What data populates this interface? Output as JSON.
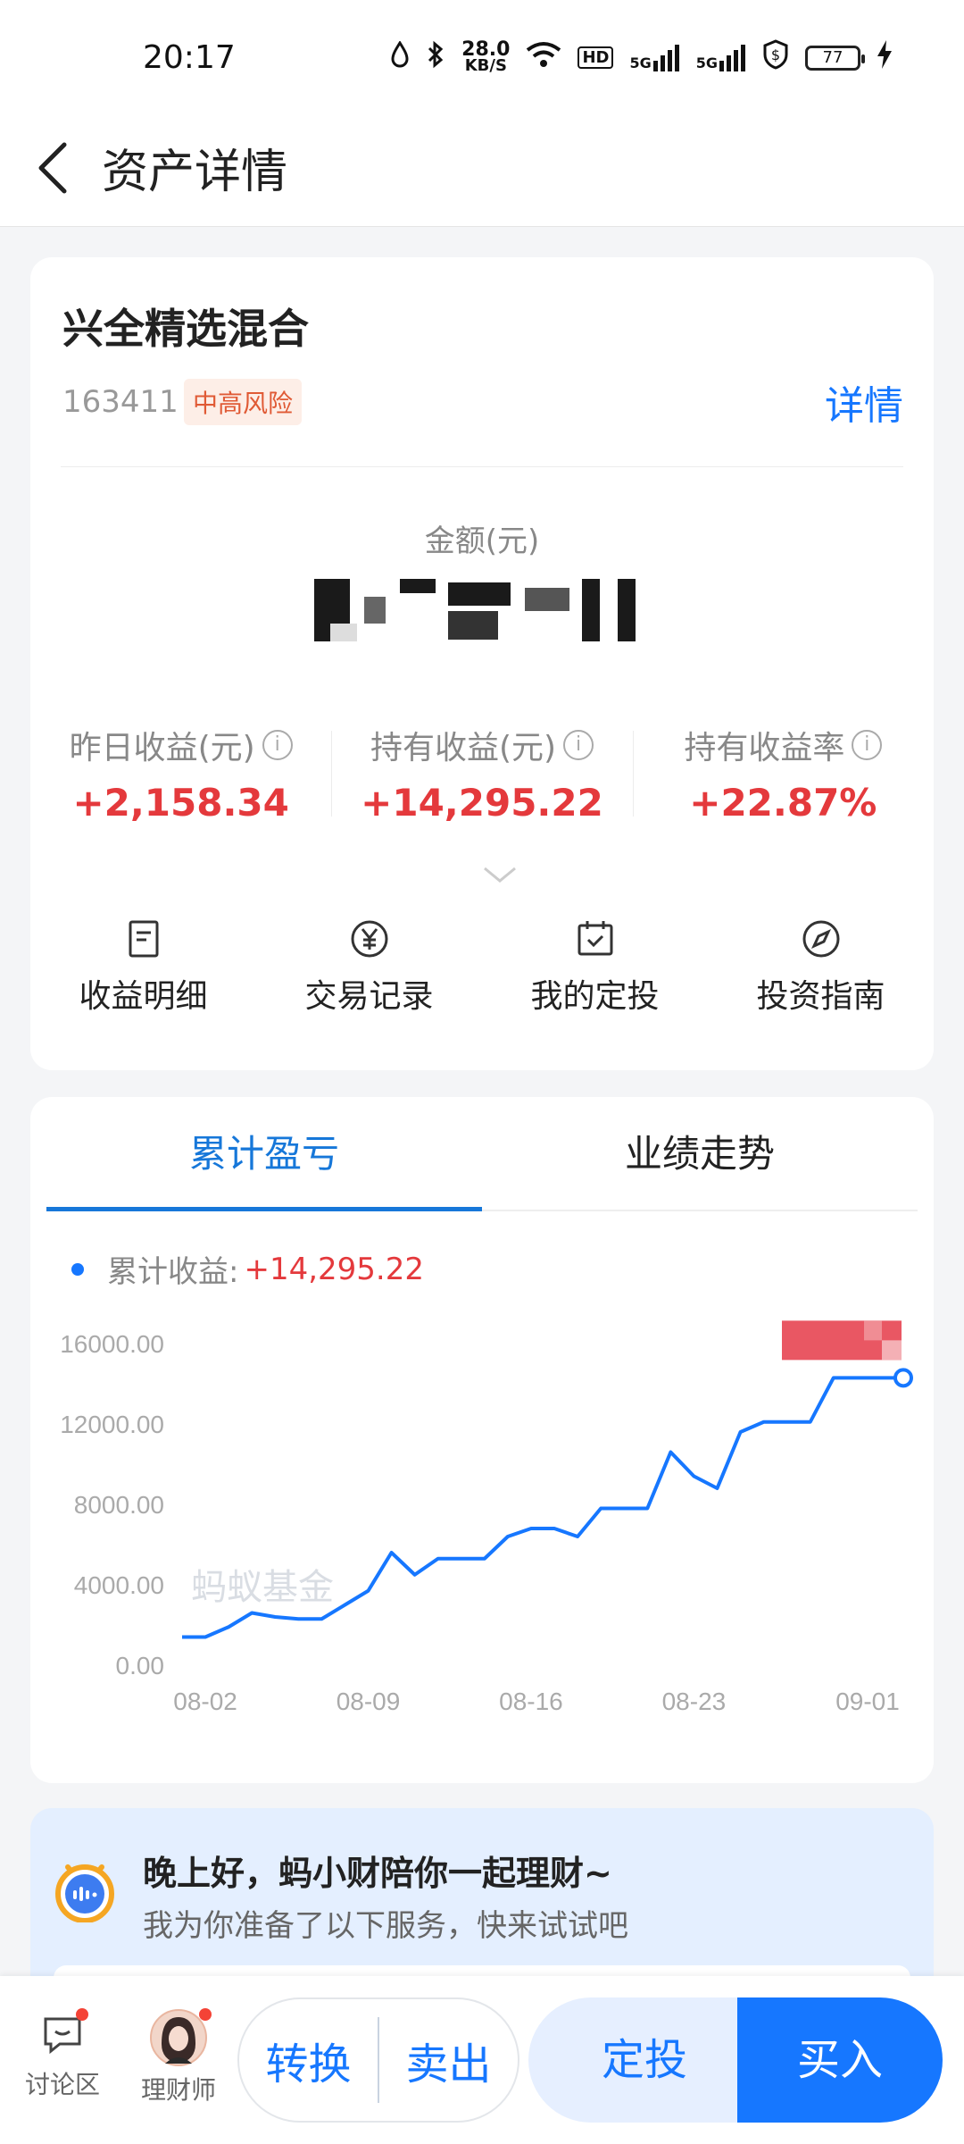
{
  "status_bar": {
    "time": "20:17",
    "net_speed": "28.0",
    "net_unit": "KB/S",
    "hd": "HD",
    "network_1": "5G",
    "network_2": "5G",
    "battery": "77"
  },
  "nav": {
    "title": "资产详情"
  },
  "fund": {
    "name": "兴全精选混合",
    "code": "163411",
    "risk": "中高风险",
    "detail_link": "详情",
    "amount_label": "金额(元)",
    "stats": [
      {
        "label": "昨日收益(元)",
        "value": "+2,158.34"
      },
      {
        "label": "持有收益(元)",
        "value": "+14,295.22"
      },
      {
        "label": "持有收益率",
        "value": "+22.87%"
      }
    ],
    "info_glyph": "i",
    "actions": [
      {
        "label": "收益明细",
        "icon": "document-icon"
      },
      {
        "label": "交易记录",
        "icon": "yen-circle-icon"
      },
      {
        "label": "我的定投",
        "icon": "calendar-check-icon"
      },
      {
        "label": "投资指南",
        "icon": "compass-icon"
      }
    ]
  },
  "chart_tabs": [
    "累计盈亏",
    "业绩走势"
  ],
  "legend": {
    "label": "累计收益:",
    "value": "+14,295.22"
  },
  "watermark": "蚂蚁基金",
  "chart_data": {
    "type": "line",
    "ylim": [
      0,
      16000
    ],
    "y_ticks": [
      "16000.00",
      "12000.00",
      "8000.00",
      "4000.00",
      "0.00"
    ],
    "y_tick_values": [
      16000,
      12000,
      8000,
      4000,
      0
    ],
    "x_tick_labels": [
      "08-02",
      "08-09",
      "08-16",
      "08-23",
      "09-01"
    ],
    "x_tick_positions": [
      1,
      8,
      15,
      22,
      31
    ],
    "series": [
      {
        "x": [
          0,
          1,
          2,
          3,
          4,
          5,
          6,
          7,
          8,
          9,
          10,
          11,
          12,
          13,
          14,
          15,
          16,
          17,
          18,
          19,
          20,
          21,
          22,
          23,
          24,
          25,
          26,
          27,
          28,
          29,
          30,
          31
        ],
        "values": [
          1400,
          1400,
          1900,
          2600,
          2400,
          2300,
          2300,
          3000,
          3700,
          5600,
          4500,
          5300,
          5300,
          5300,
          6400,
          6800,
          6800,
          6400,
          7800,
          7800,
          7800,
          10600,
          9400,
          8800,
          11600,
          12100,
          12100,
          12100,
          14295,
          14295,
          14295,
          14295
        ]
      }
    ],
    "grid": false
  },
  "assistant": {
    "title": "晚上好，蚂小财陪你一起理财~",
    "subtitle": "我为你准备了以下服务，快来试试吧"
  },
  "bottom_bar": {
    "discussion": "讨论区",
    "advisor": "理财师",
    "convert": "转换",
    "sell": "卖出",
    "auto_invest": "定投",
    "buy": "买入"
  },
  "colors": {
    "primary": "#1677ff",
    "gain": "#e4393c",
    "risk": "#e05a35"
  }
}
